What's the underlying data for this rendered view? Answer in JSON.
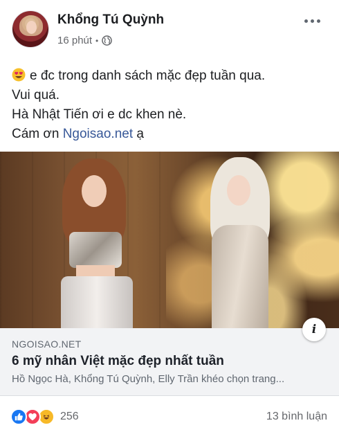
{
  "post": {
    "author": "Khổng Tú Quỳnh",
    "time": "16 phút",
    "separator": "•",
    "privacy_icon": "globe-icon",
    "text_lines": {
      "line1_emoji": "heart-eyes-emoji",
      "line1": "e đc trong danh sách mặc đẹp tuần qua.",
      "line2": "Vui quá.",
      "line3": "Hà Nhật Tiến ơi e dc khen nè.",
      "line4_prefix": "Cám ơn ",
      "line4_link": "Ngoisao.net",
      "line4_suffix": " ạ"
    }
  },
  "link_preview": {
    "domain": "NGOISAO.NET",
    "title": "6 mỹ nhân Việt mặc đẹp nhất tuần",
    "description": "Hồ Ngọc Hà, Khổng Tú Quỳnh, Elly Trần khéo chọn trang...",
    "info_label": "i"
  },
  "engagement": {
    "reaction_icons": [
      "like-icon",
      "love-icon",
      "haha-icon"
    ],
    "reaction_count": "256",
    "comments": "13 bình luận"
  },
  "colors": {
    "link": "#385898",
    "like": "#1877f2",
    "love": "#f33e58",
    "haha": "#f7b928",
    "meta_text": "#65676b"
  }
}
